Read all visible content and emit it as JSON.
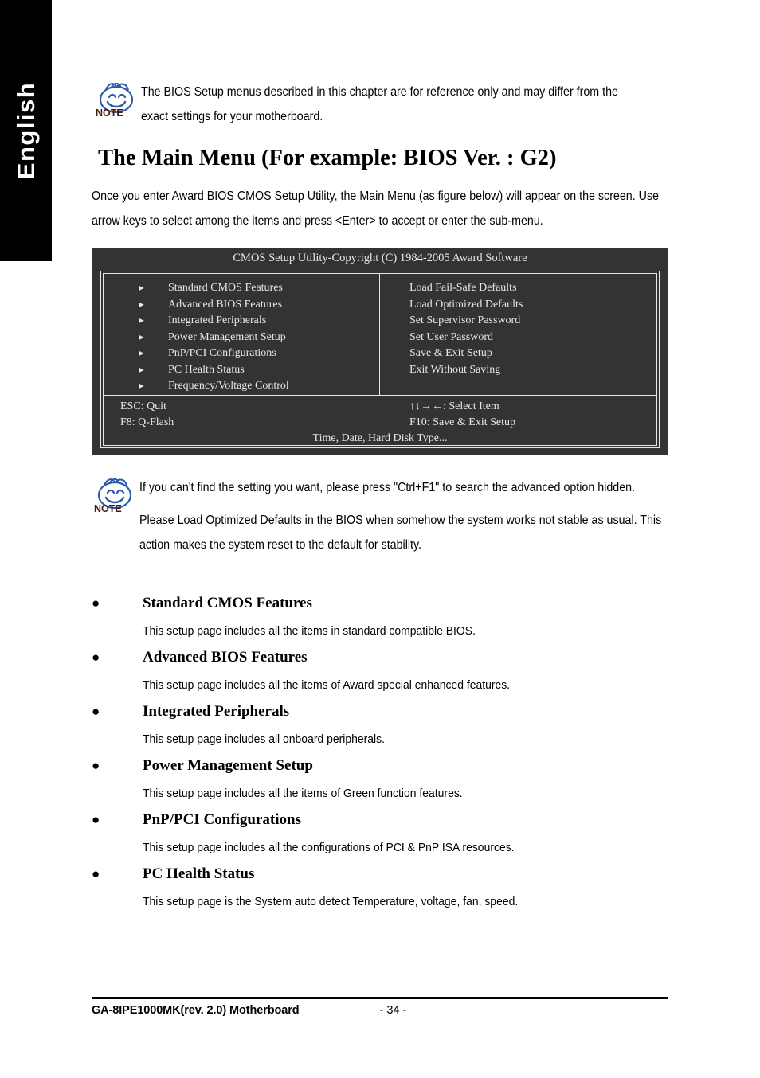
{
  "sidebar": {
    "language_label": "English"
  },
  "notes": [
    {
      "icon": "note-smiley-icon",
      "badge": "NOTE",
      "text": "The BIOS Setup menus described in this chapter are for reference only and may differ from the exact settings for your motherboard."
    },
    {
      "icon": "note-smiley-icon",
      "badge": "NOTE",
      "paragraphs": [
        "If you can't find the setting you want, please press \"Ctrl+F1\" to search the advanced option hidden.",
        "Please Load Optimized Defaults in the BIOS when somehow the system works not stable as usual. This action makes the system reset to the default for stability."
      ]
    }
  ],
  "heading": "The Main Menu (For example: BIOS Ver. : G2)",
  "intro": "Once you enter Award BIOS CMOS Setup Utility, the Main Menu (as figure below) will appear on the screen.  Use arrow keys to select among the items and press <Enter> to accept or enter the sub-menu.",
  "bios_screen": {
    "title": "CMOS Setup Utility-Copyright (C) 1984-2005 Award Software",
    "left_items": [
      "Standard CMOS Features",
      "Advanced BIOS Features",
      "Integrated Peripherals",
      "Power Management Setup",
      "PnP/PCI Configurations",
      "PC Health Status",
      "Frequency/Voltage Control"
    ],
    "right_items": [
      "Load Fail-Safe Defaults",
      "Load Optimized Defaults",
      "Set Supervisor Password",
      "Set User Password",
      "Save & Exit Setup",
      "Exit Without Saving"
    ],
    "keys": {
      "esc": "ESC: Quit",
      "f8": "F8: Q-Flash",
      "select": "↑↓→←: Select Item",
      "f10": "F10: Save & Exit Setup"
    },
    "status_bar": "Time, Date, Hard Disk Type...",
    "bg_color": "#333333",
    "fg_color": "#e8e8e2"
  },
  "sections": [
    {
      "title": "Standard CMOS Features",
      "description": "This setup page includes all the items in standard compatible BIOS."
    },
    {
      "title": "Advanced BIOS Features",
      "description": "This setup page includes all the items of Award special enhanced features."
    },
    {
      "title": "Integrated Peripherals",
      "description": "This setup page includes all onboard peripherals."
    },
    {
      "title": "Power Management Setup",
      "description": "This setup page includes all the items of Green function features."
    },
    {
      "title": "PnP/PCI Configurations",
      "description": "This setup page includes all the configurations of PCI & PnP ISA resources."
    },
    {
      "title": "PC Health Status",
      "description": "This setup page is the System auto detect Temperature, voltage, fan, speed."
    }
  ],
  "footer": {
    "product": "GA-8IPE1000MK(rev. 2.0) Motherboard",
    "page_number": "- 34 -"
  }
}
